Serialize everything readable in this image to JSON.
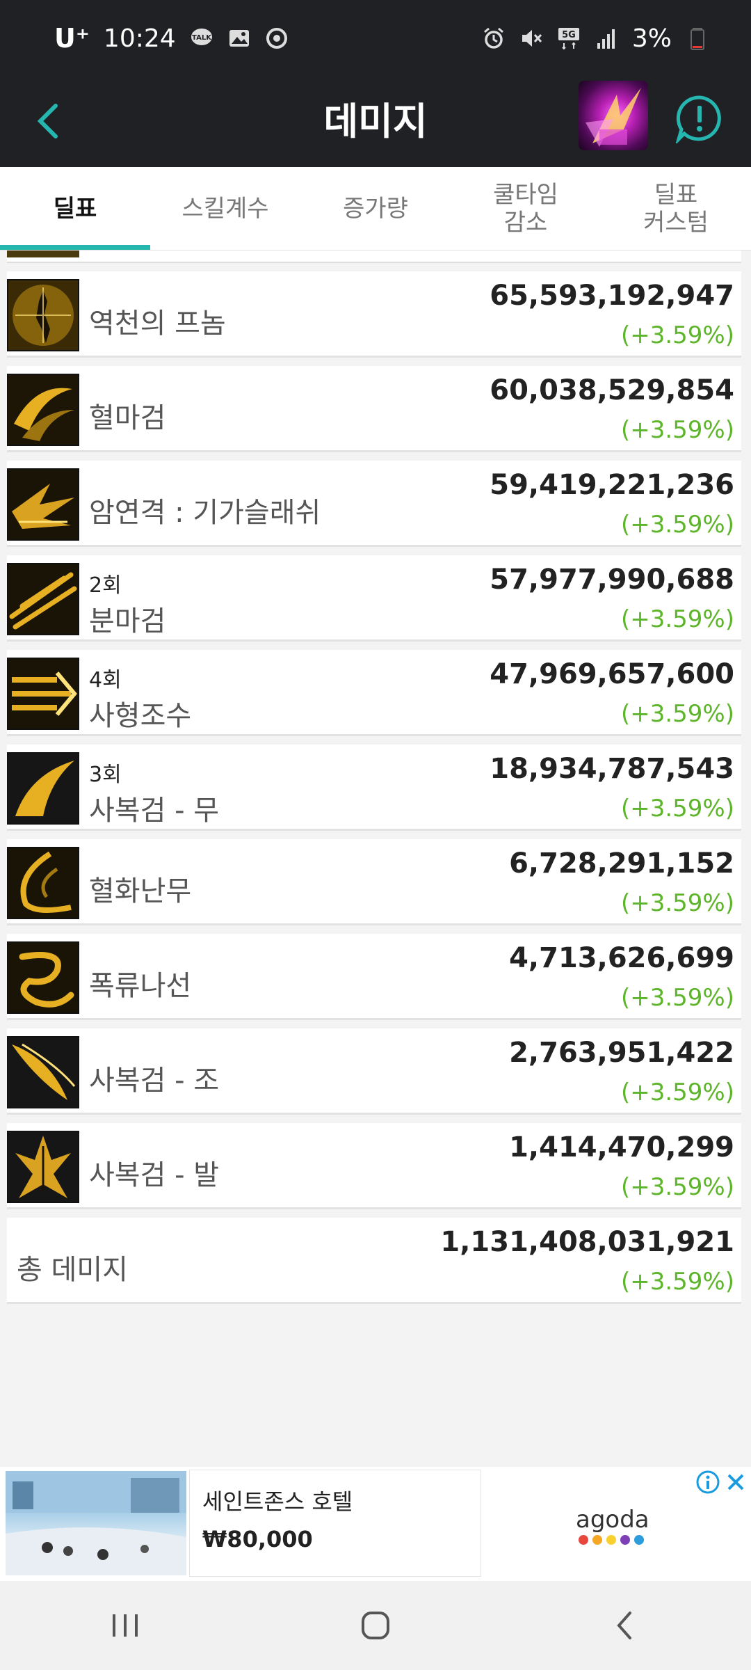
{
  "status_bar": {
    "carrier": "U⁺",
    "time": "10:24",
    "battery": "3%",
    "network": "5G",
    "left_icons": [
      "talk-icon",
      "gallery-icon",
      "sync-icon"
    ],
    "right_icons": [
      "alarm-icon",
      "mute-icon",
      "5g-icon",
      "signal-icon",
      "battery-icon"
    ]
  },
  "app_bar": {
    "title": "데미지",
    "back_icon": "chevron-left-icon",
    "alert_icon": "alert-chat-icon",
    "accent_color": "#26b6b0"
  },
  "tabs": [
    {
      "label": "딜표",
      "active": true
    },
    {
      "label": "스킬계수",
      "active": false
    },
    {
      "label": "증가량",
      "active": false
    },
    {
      "label": "쿨타임\n감소",
      "active": false
    },
    {
      "label": "딜표\n커스텀",
      "active": false
    }
  ],
  "skills": [
    {
      "name": "역천의 프놈",
      "count": "",
      "damage": "65,593,192,947",
      "change": "(+3.59%)"
    },
    {
      "name": "혈마검",
      "count": "",
      "damage": "60,038,529,854",
      "change": "(+3.59%)"
    },
    {
      "name": "암연격 : 기가슬래쉬",
      "count": "",
      "damage": "59,419,221,236",
      "change": "(+3.59%)"
    },
    {
      "name": "분마검",
      "count": "2회",
      "damage": "57,977,990,688",
      "change": "(+3.59%)"
    },
    {
      "name": "사형조수",
      "count": "4회",
      "damage": "47,969,657,600",
      "change": "(+3.59%)"
    },
    {
      "name": "사복검 - 무",
      "count": "3회",
      "damage": "18,934,787,543",
      "change": "(+3.59%)"
    },
    {
      "name": "혈화난무",
      "count": "",
      "damage": "6,728,291,152",
      "change": "(+3.59%)"
    },
    {
      "name": "폭류나선",
      "count": "",
      "damage": "4,713,626,699",
      "change": "(+3.59%)"
    },
    {
      "name": "사복검 - 조",
      "count": "",
      "damage": "2,763,951,422",
      "change": "(+3.59%)"
    },
    {
      "name": "사복검 - 발",
      "count": "",
      "damage": "1,414,470,299",
      "change": "(+3.59%)"
    }
  ],
  "total": {
    "label": "총 데미지",
    "damage": "1,131,408,031,921",
    "change": "(+3.59%)"
  },
  "ad": {
    "title": "세인트존스 호텔",
    "price": "₩80,000",
    "brand": "agoda",
    "dot_colors": [
      "#e8473e",
      "#f5a623",
      "#f8d12f",
      "#7c3fb5",
      "#2d9cdb"
    ]
  },
  "nav_bar": {
    "recent_icon": "recent-apps-icon",
    "home_icon": "home-icon",
    "back_icon": "back-icon"
  },
  "colors": {
    "increase_green": "#5db52a",
    "header_bg": "#202124"
  }
}
